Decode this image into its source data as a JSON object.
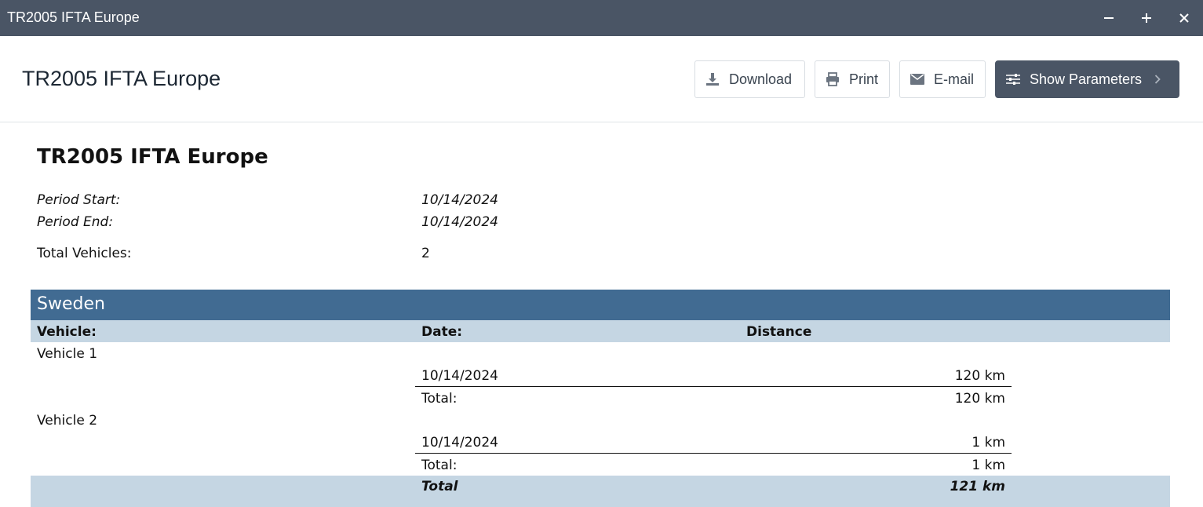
{
  "window": {
    "title": "TR2005 IFTA Europe"
  },
  "toolbar": {
    "heading": "TR2005 IFTA Europe",
    "download_label": "Download",
    "print_label": "Print",
    "email_label": "E-mail",
    "show_parameters_label": "Show Parameters"
  },
  "report": {
    "title": "TR2005 IFTA Europe",
    "period_start_label": "Period Start:",
    "period_start_value": "10/14/2024",
    "period_end_label": "Period End:",
    "period_end_value": "10/14/2024",
    "total_vehicles_label": "Total Vehicles:",
    "total_vehicles_value": "2",
    "section": {
      "country": "Sweden",
      "columns": [
        "Vehicle:",
        "Date:",
        "Distance"
      ],
      "vehicles": [
        {
          "name": "Vehicle 1",
          "rows": [
            {
              "date": "10/14/2024",
              "distance": "120 km"
            }
          ],
          "total_label": "Total:",
          "total": "120 km"
        },
        {
          "name": "Vehicle 2",
          "rows": [
            {
              "date": "10/14/2024",
              "distance": "1 km"
            }
          ],
          "total_label": "Total:",
          "total": "1 km"
        }
      ],
      "grand_total_label": "Total",
      "grand_total": "121 km"
    }
  },
  "icons": {
    "minimize": "minimize-icon",
    "maximize": "plus-icon",
    "close": "close-icon",
    "download": "download-icon",
    "print": "printer-icon",
    "email": "envelope-icon",
    "parameters": "sliders-icon",
    "chevron": "chevron-right-icon"
  },
  "colors": {
    "titlebar": "#4a5565",
    "country_header": "#416b92",
    "column_header": "#c5d6e3"
  }
}
